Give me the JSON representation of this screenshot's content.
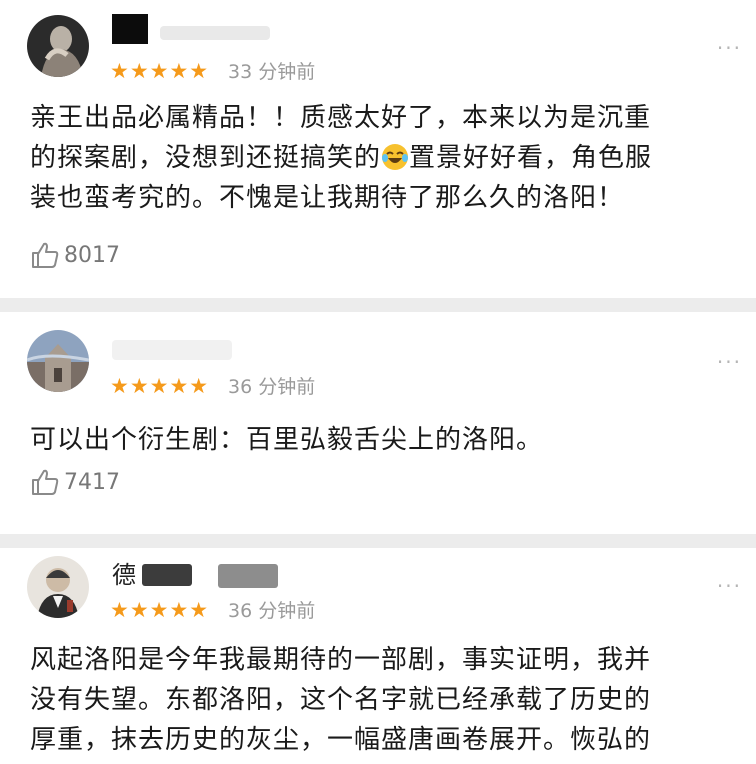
{
  "comments": [
    {
      "stars": "★★★★★",
      "time": "33 分钟前",
      "more": "···",
      "text_lines": [
        "亲王出品必属精品！！质感太好了，本来以为是沉重",
        "的探案剧，没想到还挺搞笑的",
        "置景好好看，角色服",
        "装也蛮考究的。不愧是让我期待了那么久的洛阳！"
      ],
      "likes": "8017"
    },
    {
      "stars": "★★★★★",
      "time": "36 分钟前",
      "more": "···",
      "text_lines": [
        "可以出个衍生剧：百里弘毅舌尖上的洛阳。"
      ],
      "likes": "7417"
    },
    {
      "stars": "★★★★★",
      "time": "36 分钟前",
      "more": "···",
      "name_partial": "德",
      "text_lines": [
        "风起洛阳是今年我最期待的一部剧，事实证明，我并",
        "没有失望。东都洛阳，这个名字就已经承载了历史的",
        "厚重，抹去历史的灰尘，一幅盛唐画卷展开。恢弘的"
      ]
    }
  ],
  "icons": {
    "star": "star-icon",
    "like": "thumbs-up-icon",
    "more": "more-options-icon",
    "emoji": "laughing-crying-emoji"
  },
  "colors": {
    "star": "#f59a1b",
    "time": "#9a9a9a",
    "background": "#f7f7f7"
  }
}
